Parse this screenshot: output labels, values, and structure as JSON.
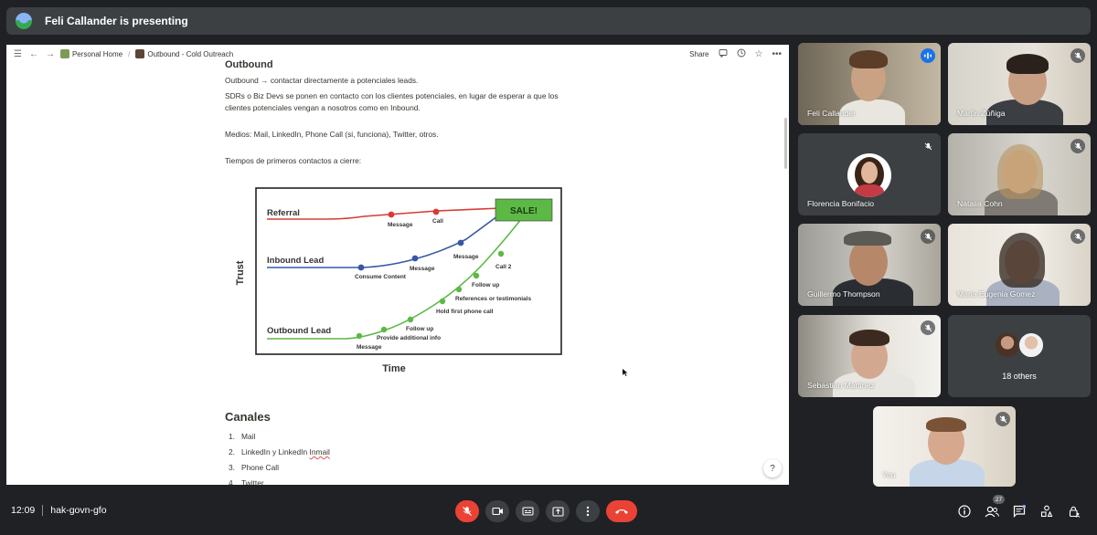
{
  "banner": {
    "text": "Feli Callander is presenting"
  },
  "notion": {
    "crumb_home": "Personal Home",
    "crumb_sep": "/",
    "crumb_page": "Outbound - Cold Outreach",
    "share_label": "Share"
  },
  "doc": {
    "heading": "Outbound",
    "p1": "Outbound → contactar directamente a potenciales leads.",
    "p2a": "SDRs o Biz Devs se ponen en contacto con los clientes potenciales, en lugar de esperar a que los",
    "p2b": "clientes potenciales vengan a nosotros como en Inbound.",
    "p3": "Medios: Mail, LinkedIn, Phone Call (si, funciona), Twitter, otros.",
    "p4": "Tiempos de primeros contactos a cierre:",
    "canales_heading": "Canales",
    "canales": [
      {
        "num": "1.",
        "label": "Mail"
      },
      {
        "num": "2.",
        "label_a": "LinkedIn y LinkedIn ",
        "label_b": "Inmail"
      },
      {
        "num": "3.",
        "label": "Phone Call"
      },
      {
        "num": "4.",
        "label": "Twitter"
      }
    ],
    "help": "?"
  },
  "chart": {
    "ylabel": "Trust",
    "xlabel": "Time",
    "sale_label": "SALE!",
    "series_referral": "Referral",
    "series_inbound": "Inbound Lead",
    "series_outbound": "Outbound Lead",
    "points": {
      "ref_message": "Message",
      "ref_call": "Call",
      "in_consume": "Consume Content",
      "in_message1": "Message",
      "in_message2": "Message",
      "out_message": "Message",
      "out_provide": "Provide additional info",
      "out_followup1": "Follow up",
      "out_holdcall": "Hold first phone call",
      "out_references": "References or testimonials",
      "out_followup2": "Follow up",
      "out_call2": "Call 2"
    },
    "colors": {
      "referral": "#d83a35",
      "inbound": "#3658a5",
      "outbound": "#5db945",
      "sale": "#5db945"
    }
  },
  "participants": [
    {
      "name": "Feli Callander"
    },
    {
      "name": "Martin Zúñiga"
    },
    {
      "name": "Florencia Bonifacio"
    },
    {
      "name": "Natalia Cohn"
    },
    {
      "name": "Guillermo Thompson"
    },
    {
      "name": "Maria Eugenia Gomez"
    },
    {
      "name": "Sebastian Martinez"
    },
    {
      "name": "You"
    }
  ],
  "others": {
    "label": "18 others"
  },
  "bottombar": {
    "time": "12:09",
    "meeting_code": "hak-govn-gfo",
    "participants_count": "27"
  }
}
